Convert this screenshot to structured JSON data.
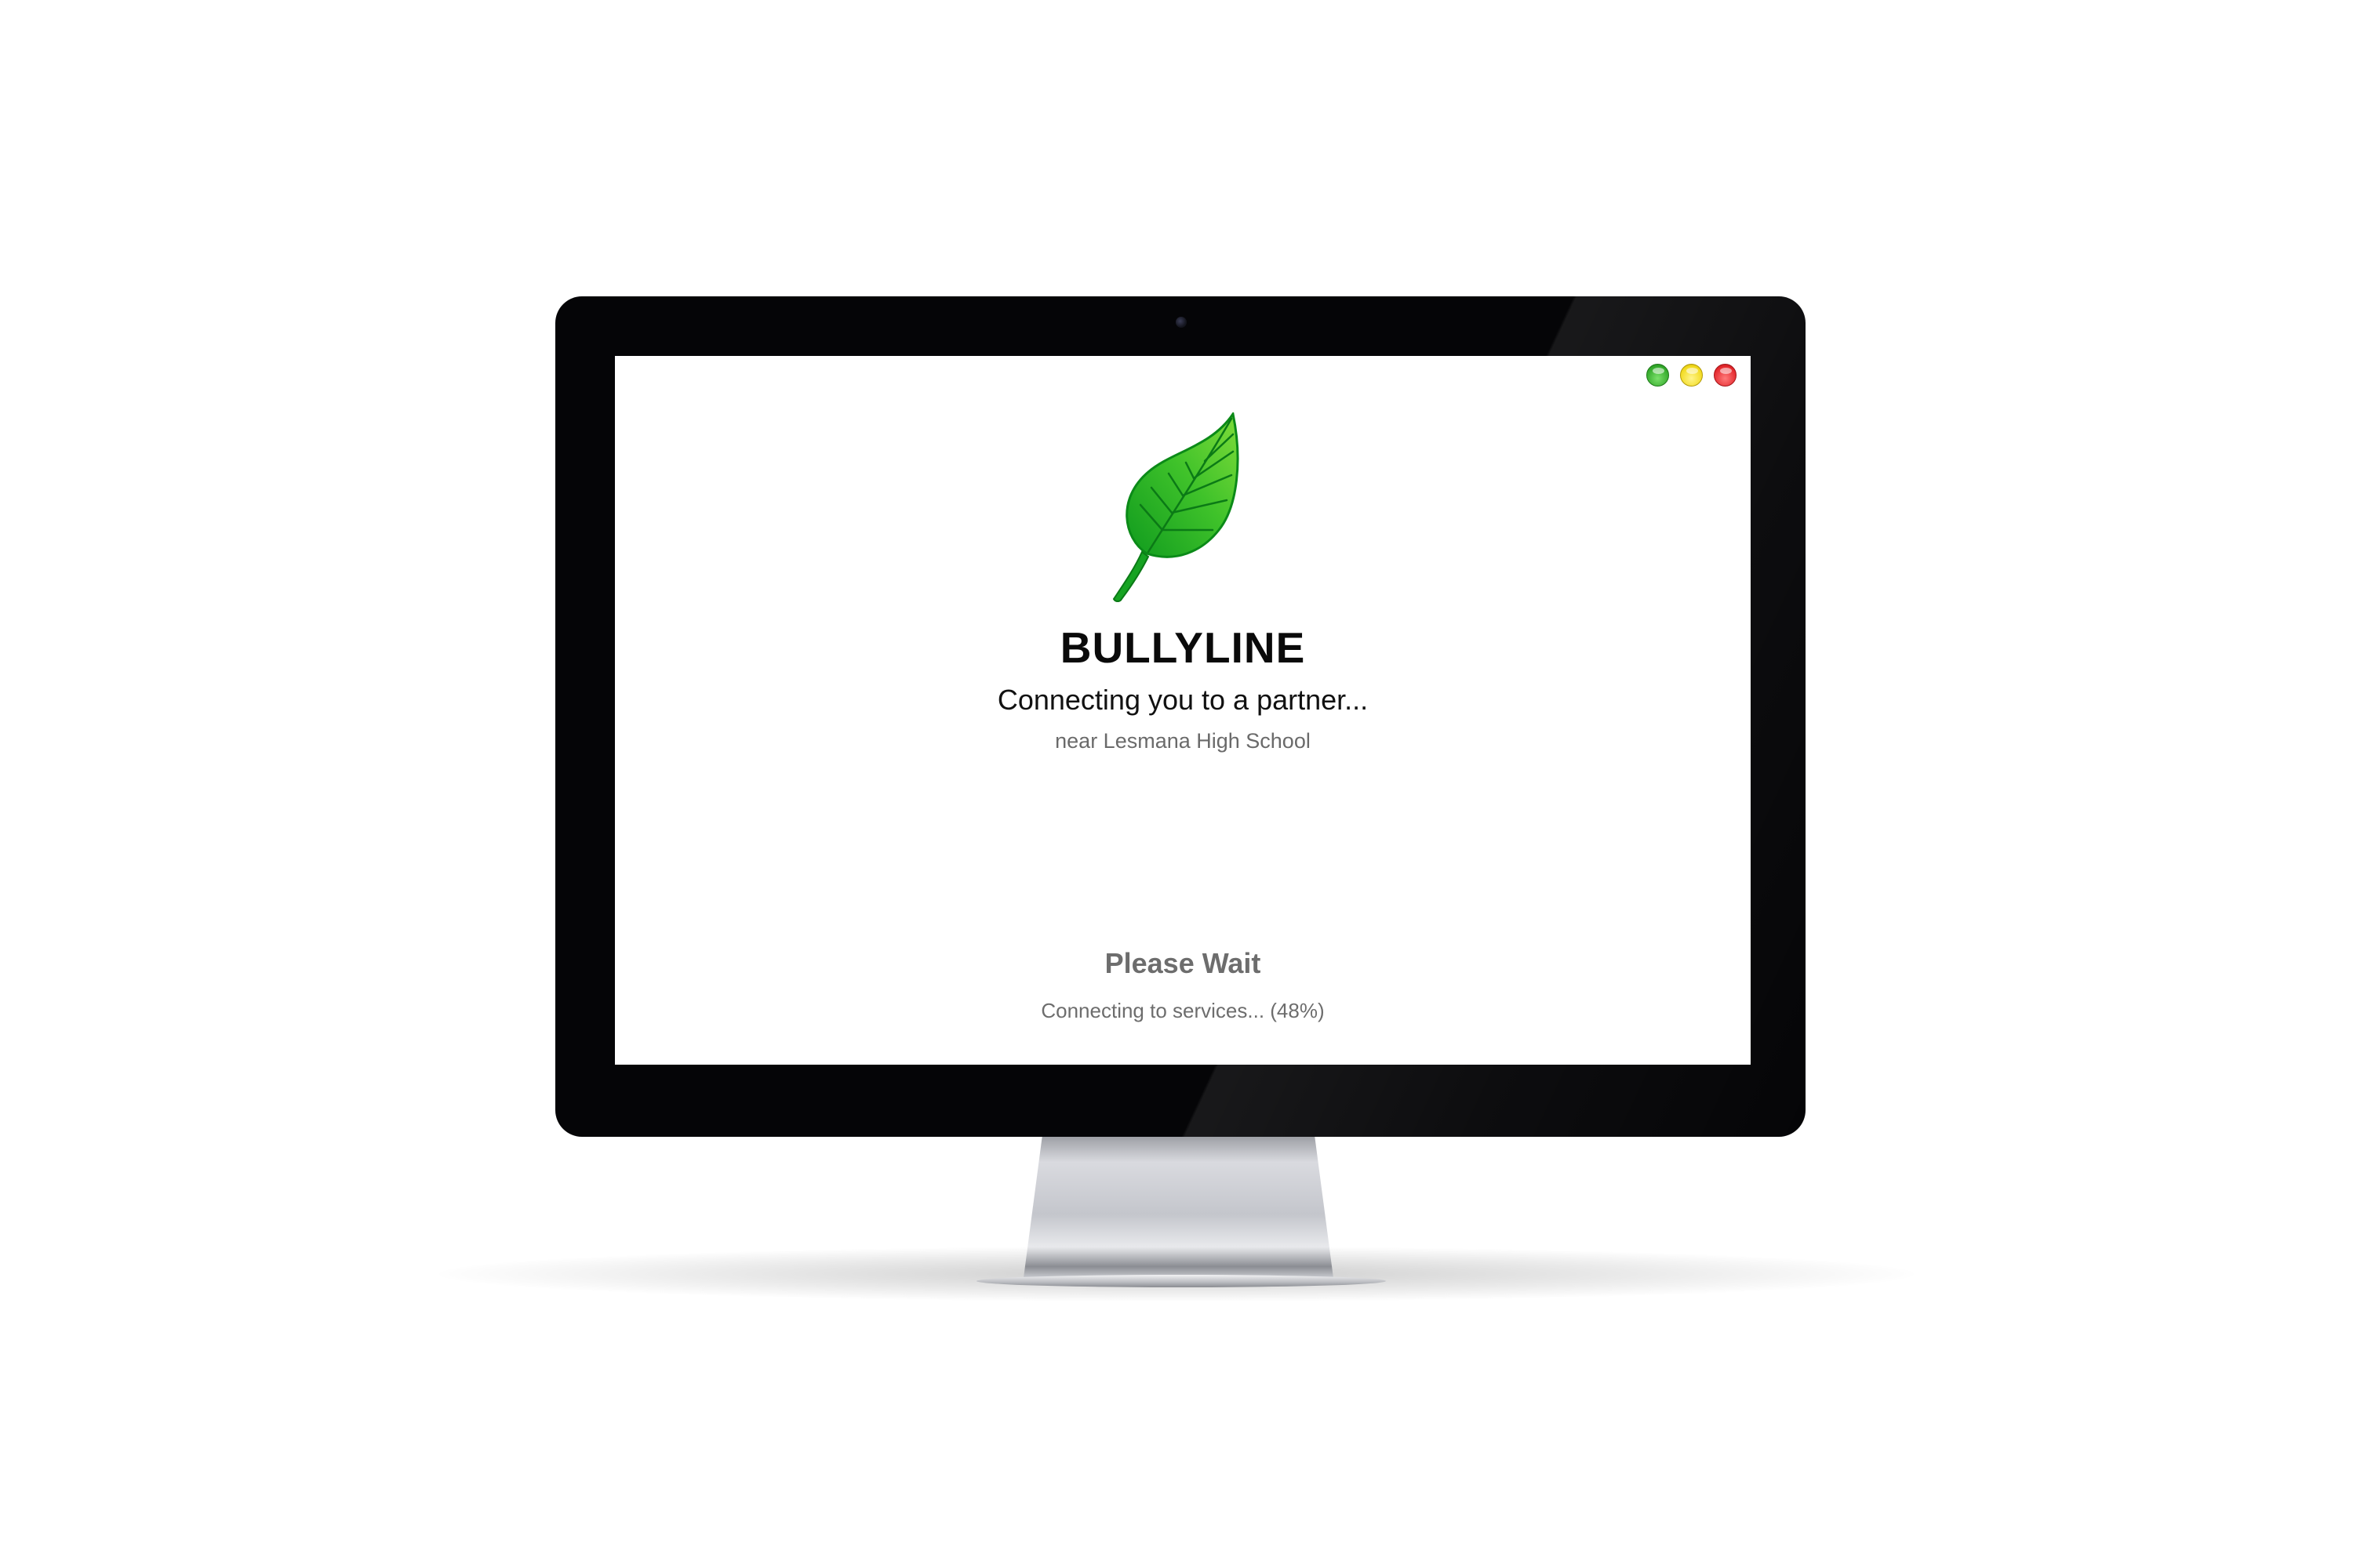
{
  "window_controls": {
    "colors": {
      "maximize": "#32a82a",
      "minimize": "#f1d91a",
      "close": "#e3262b"
    }
  },
  "logo": {
    "icon": "leaf-icon",
    "colors": {
      "leaf_light": "#7fdc3a",
      "leaf_dark": "#0f9a1e",
      "vein": "#0b7a16"
    }
  },
  "app": {
    "title": "BULLYLINE",
    "status_headline": "Connecting you to a partner...",
    "location": "near Lesmana High School"
  },
  "loading": {
    "title": "Please Wait",
    "progress_text": "Connecting to services... (48%)",
    "progress_percent": 48
  }
}
